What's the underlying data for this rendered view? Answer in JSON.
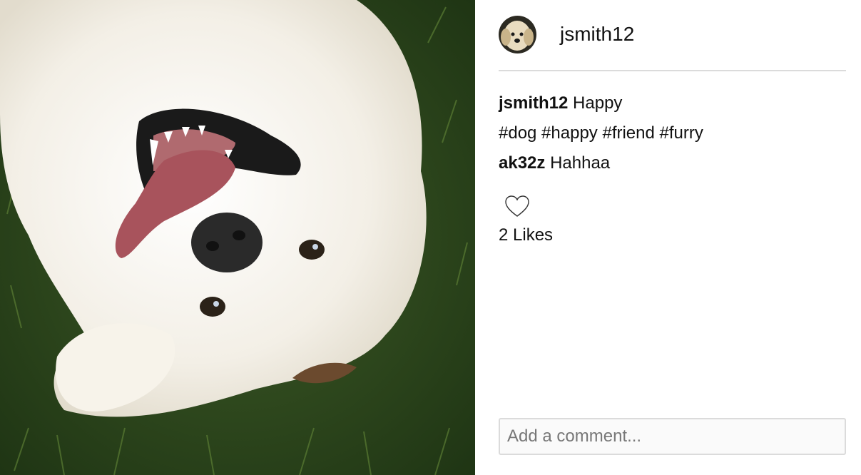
{
  "post": {
    "author": "jsmith12",
    "caption": "Happy",
    "hashtags": "#dog #happy #friend #furry"
  },
  "comments": [
    {
      "author": "ak32z",
      "text": "Hahhaa"
    }
  ],
  "likes": {
    "label": "2 Likes"
  },
  "comment_input": {
    "placeholder": "Add a comment..."
  },
  "icons": {
    "like": "heart-outline-icon"
  },
  "colors": {
    "divider": "#dbdbdb",
    "grass": "#2f4a1f",
    "fur": "#f4f0e8"
  }
}
